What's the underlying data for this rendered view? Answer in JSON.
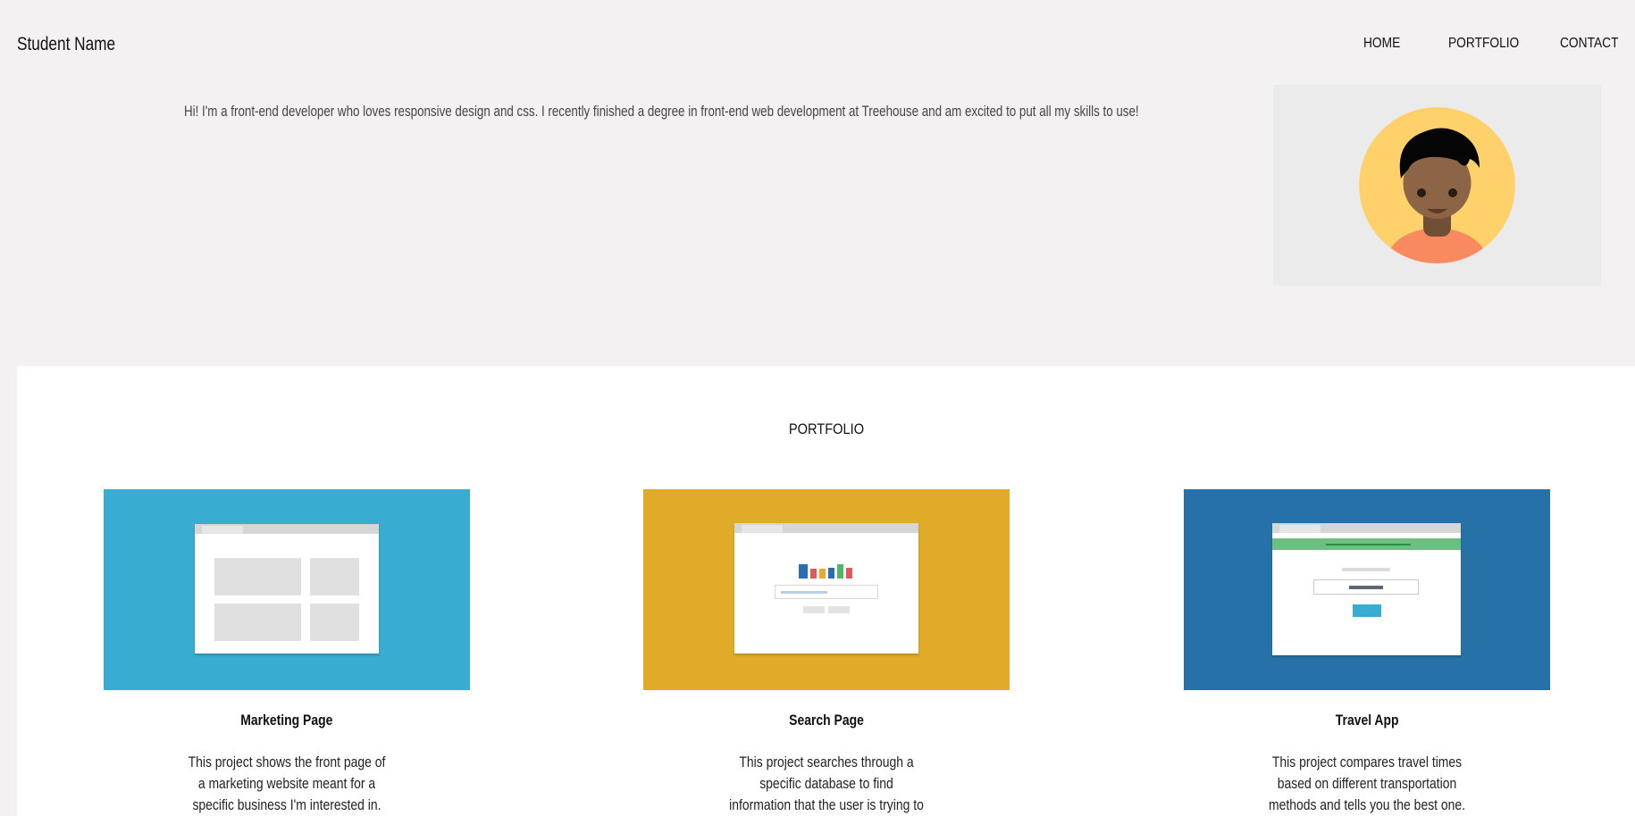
{
  "header": {
    "site_title": "Student Name",
    "nav": [
      {
        "label": "HOME"
      },
      {
        "label": "PORTFOLIO"
      },
      {
        "label": "CONTACT"
      }
    ]
  },
  "intro": {
    "text": "Hi! I'm a front-end developer who loves responsive design and css. I recently finished a degree in front-end web development at Treehouse and am excited to put all my skills to use!"
  },
  "portfolio": {
    "heading": "PORTFOLIO",
    "projects": [
      {
        "title": "Marketing Page",
        "description": "This project shows the front page of a marketing website meant for a specific business I'm interested in.",
        "thumb_color": "#38acd1"
      },
      {
        "title": "Search Page",
        "description": "This project searches through a specific database to find information that the user is trying to look up.",
        "thumb_color": "#dfab29"
      },
      {
        "title": "Travel App",
        "description": "This project compares travel times based on different transportation methods and tells you the best one.",
        "thumb_color": "#2571a8"
      }
    ]
  },
  "colors": {
    "page_background": "#f3f1f2",
    "avatar_background": "#ffd16b",
    "skin": "#8b6546",
    "shirt": "#f98a5f"
  }
}
